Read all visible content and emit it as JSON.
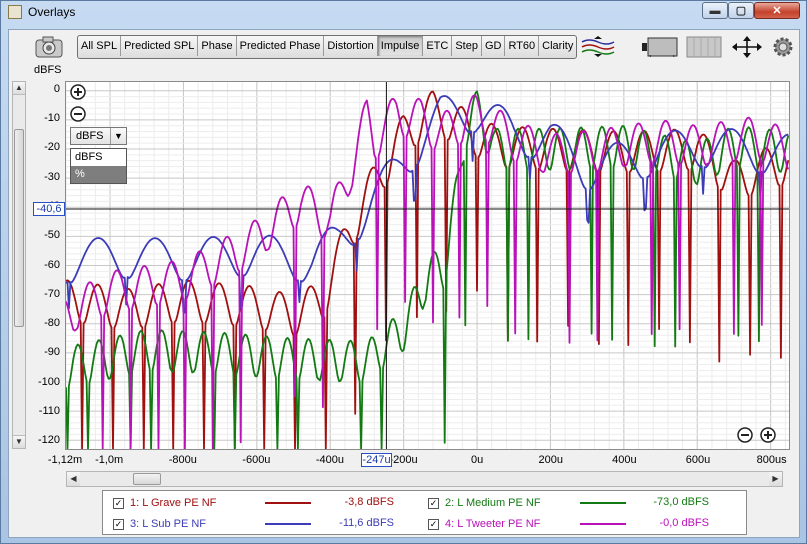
{
  "window": {
    "title": "Overlays",
    "min_label": "▬",
    "max_label": "▢",
    "close_label": "✕"
  },
  "tabs": [
    "All SPL",
    "Predicted SPL",
    "Phase",
    "Predicted Phase",
    "Distortion",
    "Impulse",
    "ETC",
    "Step",
    "GD",
    "RT60",
    "Clarity"
  ],
  "active_tab": "Impulse",
  "toolbar_icons": [
    "camera-icon",
    "traces-icon",
    "layout-icon",
    "grid-icon",
    "pan-arrows-icon",
    "gear-icon"
  ],
  "y_axis": {
    "unit": "dBFS",
    "ticks": [
      "0",
      "-10",
      "-20",
      "-30",
      "-40",
      "-50",
      "-60",
      "-70",
      "-80",
      "-90",
      "-100",
      "-110",
      "-120"
    ]
  },
  "x_axis": {
    "ticks": [
      "-1,12m",
      "-1,0m",
      "-800u",
      "-600u",
      "-400u",
      "-200u",
      "0u",
      "200u",
      "400u",
      "600u",
      "800us"
    ]
  },
  "cursor": {
    "x_readout": "-247u",
    "y_readout": "-40,6"
  },
  "unit_select": {
    "value": "dBFS",
    "options": [
      "dBFS",
      "%"
    ]
  },
  "zoom": {
    "in_label": "+",
    "out_label": "−"
  },
  "legend": [
    {
      "label": "1: L Grave PE NF",
      "value": "-3,8 dBFS",
      "color": "#a01010",
      "checked": "✓"
    },
    {
      "label": "2: L Medium PE NF",
      "value": "-73,0 dBFS",
      "color": "#137a13",
      "checked": "✓"
    },
    {
      "label": "3: L Sub PE NF",
      "value": "-11,6 dBFS",
      "color": "#3c3cb8",
      "checked": "✓"
    },
    {
      "label": "4: L Tweeter PE NF",
      "value": "-0,0 dBFS",
      "color": "#b812b8",
      "checked": "✓"
    }
  ],
  "chart_data": {
    "type": "line",
    "ylabel": "dBFS",
    "ylim": [
      -123,
      3
    ],
    "xlim": [
      -1.12,
      0.85
    ],
    "x_unit": "ms",
    "grid": true,
    "series": [
      {
        "name": "1: L Grave PE NF",
        "color": "#a01010",
        "x": [
          -1.12,
          -0.95,
          -0.8,
          -0.62,
          -0.5,
          -0.42,
          -0.35,
          -0.28,
          -0.2,
          -0.12,
          -0.05,
          0.05,
          0.2,
          0.4,
          0.6,
          0.7,
          0.8,
          0.85
        ],
        "y": [
          -65,
          -68,
          -65,
          -67,
          -70,
          -65,
          -42,
          -25,
          -8,
          0,
          -5,
          -12,
          -13,
          -14,
          -13,
          -24,
          -19,
          -18
        ]
      },
      {
        "name": "2: L Medium PE NF",
        "color": "#137a13",
        "x": [
          -1.12,
          -0.9,
          -0.7,
          -0.5,
          -0.3,
          -0.2,
          -0.13,
          -0.09,
          -0.05,
          -0.03,
          0.0,
          0.05,
          0.2,
          0.4,
          0.6,
          0.7,
          0.85
        ],
        "y": [
          -88,
          -82,
          -83,
          -85,
          -86,
          -75,
          -56,
          -54,
          -25,
          -5,
          0,
          -13,
          -13,
          -12,
          -18,
          -12,
          -14
        ]
      },
      {
        "name": "3: L Sub PE NF",
        "color": "#3c3cb8",
        "x": [
          -1.12,
          -1.0,
          -0.8,
          -0.6,
          -0.45,
          -0.38,
          -0.3,
          -0.2,
          -0.1,
          0.0,
          0.1,
          0.2,
          0.3,
          0.45,
          0.6,
          0.85
        ],
        "y": [
          -52,
          -50,
          -51,
          -49,
          -52,
          -45,
          -34,
          -17,
          -2,
          0,
          -8,
          -10,
          -20,
          -16,
          -12,
          -15
        ]
      },
      {
        "name": "4: L Tweeter PE NF",
        "color": "#b812b8",
        "x": [
          -1.12,
          -1.0,
          -0.8,
          -0.62,
          -0.48,
          -0.4,
          -0.34,
          -0.3,
          -0.28,
          -0.22,
          -0.15,
          -0.1,
          0.0,
          0.1,
          0.2,
          0.35,
          0.5,
          0.6,
          0.75,
          0.85
        ],
        "y": [
          -70,
          -62,
          -58,
          -46,
          -31,
          -38,
          -19,
          -2,
          -10,
          -1,
          -3,
          -8,
          -1,
          -10,
          -15,
          -13,
          -10,
          -12,
          -9,
          -13
        ]
      }
    ]
  }
}
